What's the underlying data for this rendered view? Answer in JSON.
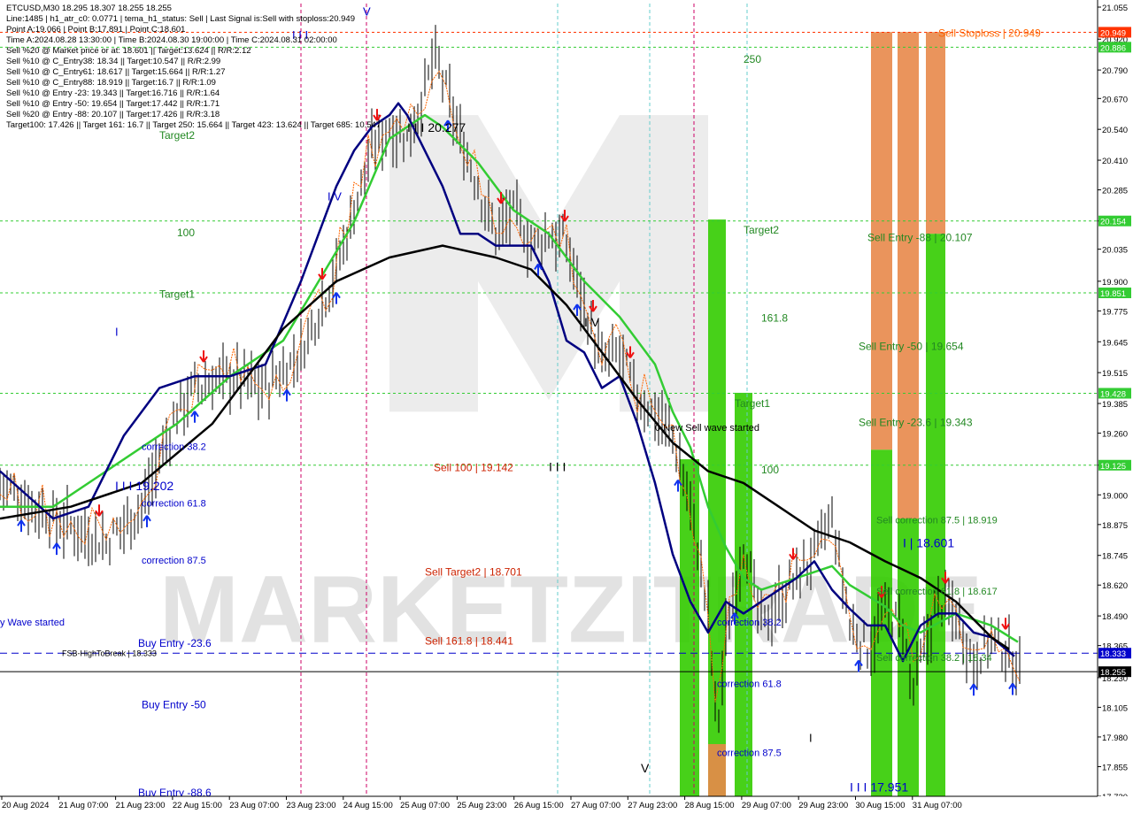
{
  "header": {
    "lines": [
      "ETCUSD,M30  18.295 18.307 18.255 18.255",
      "Line:1485 | h1_atr_c0: 0.0771 | tema_h1_status: Sell | Last Signal is:Sell with stoploss:20.949",
      "Point A:19.066 | Point B:17.891 | Point C:18.601",
      "Time A:2024.08.28 13:30:00 | Time B:2024.08.30 19:00:00 | Time C:2024.08.31 02:00:00",
      "Sell %20 @ Market price or at: 18.601 || Target:13.624 || R/R:2.12",
      "Sell %10 @ C_Entry38: 18.34 || Target:10.547 || R/R:2.99",
      "Sell %10 @ C_Entry61: 18.617 || Target:15.664 || R/R:1.27",
      "Sell %10 @ C_Entry88: 18.919 || Target:16.7 || R/R:1.09",
      "Sell %10 @ Entry -23: 19.343 || Target:16.716 || R/R:1.64",
      "Sell %10 @ Entry -50: 19.654 || Target:17.442 || R/R:1.71",
      "Sell %20 @ Entry -88: 20.107 || Target:17.426 || R/R:3.18",
      "Target100: 17.426 || Target 161: 16.7 || Target 250: 15.664 || Target 423: 13.624 || Target 685: 10.547"
    ]
  },
  "colors": {
    "bull": "#000000",
    "green_ma": "#33cc33",
    "navy_ma": "#000080",
    "black_ma": "#000000",
    "orange": "#ff6600",
    "green_zone": "#33cc00",
    "orange_zone": "#e8884a",
    "level_line": "#006600",
    "stop_line": "#ff3300",
    "blue_line": "#0000cc",
    "label_green": "#33aa33",
    "label_red": "#cc2200",
    "label_blue": "#0000cc"
  },
  "chart_data": {
    "type": "candlestick",
    "symbol": "ETCUSD",
    "timeframe": "M30",
    "ylim": [
      17.73,
      21.07
    ],
    "y_ticks": [
      "21.055",
      "20.920",
      "20.790",
      "20.670",
      "20.540",
      "20.410",
      "20.285",
      "20.154",
      "20.035",
      "19.900",
      "19.775",
      "19.645",
      "19.515",
      "19.385",
      "19.260",
      "19.125",
      "19.000",
      "18.875",
      "18.745",
      "18.620",
      "18.490",
      "18.365",
      "18.230",
      "18.105",
      "17.980",
      "17.855",
      "17.730"
    ],
    "x_labels": [
      "20 Aug 2024",
      "21 Aug 07:00",
      "21 Aug 23:00",
      "22 Aug 15:00",
      "23 Aug 07:00",
      "23 Aug 23:00",
      "24 Aug 15:00",
      "25 Aug 07:00",
      "25 Aug 23:00",
      "26 Aug 15:00",
      "27 Aug 07:00",
      "27 Aug 23:00",
      "28 Aug 15:00",
      "29 Aug 07:00",
      "29 Aug 23:00",
      "30 Aug 15:00",
      "31 Aug 07:00"
    ],
    "price_path": [
      [
        0,
        19.05
      ],
      [
        3,
        18.9
      ],
      [
        6,
        18.8
      ],
      [
        8,
        18.95
      ],
      [
        10,
        19.35
      ],
      [
        11,
        19.45
      ],
      [
        13,
        19.5
      ],
      [
        15,
        19.45
      ],
      [
        17,
        19.6
      ],
      [
        19,
        19.95
      ],
      [
        20,
        20.2
      ],
      [
        21,
        20.45
      ],
      [
        22,
        20.55
      ],
      [
        23,
        20.5
      ],
      [
        24,
        20.7
      ],
      [
        24.5,
        20.85
      ],
      [
        25,
        20.75
      ],
      [
        26,
        20.5
      ],
      [
        27,
        20.3
      ],
      [
        28,
        20.1
      ],
      [
        29,
        20.2
      ],
      [
        30,
        20.05
      ],
      [
        31,
        20.1
      ],
      [
        32,
        20.05
      ],
      [
        33,
        19.8
      ],
      [
        34,
        19.55
      ],
      [
        35,
        19.6
      ],
      [
        36,
        19.4
      ],
      [
        37,
        19.35
      ],
      [
        38,
        19.25
      ],
      [
        39,
        18.95
      ],
      [
        40,
        18.5
      ],
      [
        40.5,
        18.0
      ],
      [
        41,
        18.4
      ],
      [
        42,
        18.8
      ],
      [
        43,
        18.45
      ],
      [
        44,
        18.55
      ],
      [
        45,
        18.65
      ],
      [
        46,
        18.75
      ],
      [
        47,
        18.9
      ],
      [
        48,
        18.45
      ],
      [
        49,
        18.35
      ],
      [
        50,
        18.5
      ],
      [
        51,
        18.45
      ],
      [
        51.5,
        18.15
      ],
      [
        52,
        18.3
      ],
      [
        53,
        18.55
      ],
      [
        54,
        18.5
      ],
      [
        55,
        18.3
      ],
      [
        56,
        18.4
      ],
      [
        57,
        18.32
      ],
      [
        57.7,
        18.26
      ]
    ],
    "series": [
      {
        "name": "",
        "color": "green",
        "values": [
          [
            0,
            18.95
          ],
          [
            3,
            18.95
          ],
          [
            6,
            19.1
          ],
          [
            10,
            19.3
          ],
          [
            13,
            19.5
          ],
          [
            16,
            19.65
          ],
          [
            18,
            19.9
          ],
          [
            20,
            20.15
          ],
          [
            22,
            20.5
          ],
          [
            24,
            20.6
          ],
          [
            25,
            20.55
          ],
          [
            27,
            20.4
          ],
          [
            29,
            20.2
          ],
          [
            31,
            20.1
          ],
          [
            33,
            19.9
          ],
          [
            35,
            19.75
          ],
          [
            37,
            19.55
          ],
          [
            38,
            19.35
          ],
          [
            39,
            19.2
          ],
          [
            40,
            18.95
          ],
          [
            41,
            18.78
          ],
          [
            42,
            18.65
          ],
          [
            43,
            18.6
          ],
          [
            45,
            18.65
          ],
          [
            47,
            18.7
          ],
          [
            48,
            18.62
          ],
          [
            50,
            18.53
          ],
          [
            51,
            18.45
          ],
          [
            52,
            18.42
          ],
          [
            54,
            18.5
          ],
          [
            56,
            18.45
          ],
          [
            57.5,
            18.38
          ]
        ]
      },
      {
        "name": "",
        "color": "navy",
        "values": [
          [
            0,
            19.1
          ],
          [
            3,
            18.9
          ],
          [
            5,
            18.95
          ],
          [
            7,
            19.25
          ],
          [
            9,
            19.45
          ],
          [
            11,
            19.5
          ],
          [
            13,
            19.5
          ],
          [
            15,
            19.55
          ],
          [
            17,
            19.9
          ],
          [
            19,
            20.3
          ],
          [
            20,
            20.45
          ],
          [
            21,
            20.55
          ],
          [
            22,
            20.6
          ],
          [
            22.5,
            20.65
          ],
          [
            23,
            20.6
          ],
          [
            24,
            20.45
          ],
          [
            25,
            20.3
          ],
          [
            26,
            20.1
          ],
          [
            27,
            20.1
          ],
          [
            28,
            20.05
          ],
          [
            30,
            20.05
          ],
          [
            31,
            19.9
          ],
          [
            32,
            19.65
          ],
          [
            33,
            19.6
          ],
          [
            34,
            19.45
          ],
          [
            35,
            19.5
          ],
          [
            36,
            19.3
          ],
          [
            37,
            19.05
          ],
          [
            38,
            18.75
          ],
          [
            39,
            18.55
          ],
          [
            40,
            18.42
          ],
          [
            41,
            18.55
          ],
          [
            42,
            18.5
          ],
          [
            43,
            18.55
          ],
          [
            45,
            18.65
          ],
          [
            46,
            18.72
          ],
          [
            47,
            18.6
          ],
          [
            48,
            18.52
          ],
          [
            49,
            18.45
          ],
          [
            50,
            18.45
          ],
          [
            51,
            18.3
          ],
          [
            52,
            18.45
          ],
          [
            53,
            18.5
          ],
          [
            54,
            18.5
          ],
          [
            55,
            18.42
          ],
          [
            56,
            18.4
          ],
          [
            57.3,
            18.32
          ]
        ]
      },
      {
        "name": "",
        "color": "black",
        "values": [
          [
            0,
            18.9
          ],
          [
            4,
            18.95
          ],
          [
            8,
            19.05
          ],
          [
            12,
            19.3
          ],
          [
            16,
            19.7
          ],
          [
            19,
            19.9
          ],
          [
            22,
            20.0
          ],
          [
            25,
            20.05
          ],
          [
            28,
            20.0
          ],
          [
            30,
            19.95
          ],
          [
            32,
            19.8
          ],
          [
            34,
            19.6
          ],
          [
            36,
            19.4
          ],
          [
            38,
            19.22
          ],
          [
            40,
            19.1
          ],
          [
            42,
            19.05
          ],
          [
            44,
            18.95
          ],
          [
            46,
            18.85
          ],
          [
            48,
            18.8
          ],
          [
            50,
            18.72
          ],
          [
            52,
            18.65
          ],
          [
            54,
            18.55
          ],
          [
            56,
            18.4
          ],
          [
            57,
            18.35
          ]
        ]
      }
    ],
    "levels": [
      {
        "value": 20.949,
        "label": "20.949",
        "color": "#ff3300"
      },
      {
        "value": 20.886,
        "label": "20.886",
        "color": "#33cc33"
      },
      {
        "value": 20.154,
        "label": "20.154",
        "color": "#33cc33"
      },
      {
        "value": 19.851,
        "label": "19.851",
        "color": "#33cc33"
      },
      {
        "value": 19.428,
        "label": "19.428",
        "color": "#33cc33"
      },
      {
        "value": 19.125,
        "label": "19.125",
        "color": "#33cc33"
      },
      {
        "value": 18.333,
        "label": "18.333",
        "color": "#0000cc"
      },
      {
        "value": 18.255,
        "label": "18.255",
        "color": "#000000"
      }
    ],
    "annotations": [
      {
        "text": "Sell Stoploss | 20.949",
        "x": 53.0,
        "y": 20.93,
        "color": "#ff6600",
        "size": 12
      },
      {
        "text": "250",
        "x": 42.0,
        "y": 20.82,
        "color": "#228822",
        "size": 12
      },
      {
        "text": "Target2",
        "x": 9.0,
        "y": 20.5,
        "color": "#228822",
        "size": 12
      },
      {
        "text": "I I I 20.277",
        "x": 23.0,
        "y": 20.53,
        "color": "#000000",
        "size": 14
      },
      {
        "text": "I V",
        "x": 18.5,
        "y": 20.24,
        "color": "#0000cc",
        "size": 13
      },
      {
        "text": "100",
        "x": 10.0,
        "y": 20.09,
        "color": "#228822",
        "size": 12
      },
      {
        "text": "Target2",
        "x": 42.0,
        "y": 20.1,
        "color": "#228822",
        "size": 12
      },
      {
        "text": "Sell Entry -88 | 20.107",
        "x": 49.0,
        "y": 20.07,
        "color": "#228822",
        "size": 12
      },
      {
        "text": "Target1",
        "x": 9.0,
        "y": 19.83,
        "color": "#228822",
        "size": 12
      },
      {
        "text": "161.8",
        "x": 43.0,
        "y": 19.73,
        "color": "#228822",
        "size": 12
      },
      {
        "text": "I V",
        "x": 33.0,
        "y": 19.71,
        "color": "#000000",
        "size": 14
      },
      {
        "text": "I",
        "x": 6.5,
        "y": 19.67,
        "color": "#0000cc",
        "size": 13
      },
      {
        "text": "Sell Entry -50 | 19.654",
        "x": 48.5,
        "y": 19.61,
        "color": "#228822",
        "size": 12
      },
      {
        "text": "Target1",
        "x": 41.5,
        "y": 19.37,
        "color": "#228822",
        "size": 12
      },
      {
        "text": "0 New Sell wave started",
        "x": 37.0,
        "y": 19.27,
        "color": "#000000",
        "size": 11
      },
      {
        "text": "Sell Entry -23.6 | 19.343",
        "x": 48.5,
        "y": 19.29,
        "color": "#228822",
        "size": 12
      },
      {
        "text": "correction 38.2",
        "x": 8.0,
        "y": 19.19,
        "color": "#0000cc",
        "size": 11
      },
      {
        "text": "Sell 100 | 19.142",
        "x": 24.5,
        "y": 19.1,
        "color": "#cc2200",
        "size": 12
      },
      {
        "text": "I I I",
        "x": 31.0,
        "y": 19.1,
        "color": "#000000",
        "size": 14
      },
      {
        "text": "100",
        "x": 43.0,
        "y": 19.09,
        "color": "#228822",
        "size": 12
      },
      {
        "text": "I I I 19.202",
        "x": 6.5,
        "y": 19.02,
        "color": "#0000cc",
        "size": 14
      },
      {
        "text": "correction 61.8",
        "x": 8.0,
        "y": 18.95,
        "color": "#0000cc",
        "size": 11
      },
      {
        "text": "Sell correction 87.5 | 18.919",
        "x": 49.5,
        "y": 18.88,
        "color": "#228822",
        "size": 11
      },
      {
        "text": "I | 18.601",
        "x": 51.0,
        "y": 18.78,
        "color": "#0000cc",
        "size": 14
      },
      {
        "text": "correction 87.5",
        "x": 8.0,
        "y": 18.71,
        "color": "#0000cc",
        "size": 11
      },
      {
        "text": "Sell Target2 | 18.701",
        "x": 24.0,
        "y": 18.66,
        "color": "#cc2200",
        "size": 12
      },
      {
        "text": "Sell correction 61.8 | 18.617",
        "x": 49.5,
        "y": 18.58,
        "color": "#228822",
        "size": 11
      },
      {
        "text": "y Wave started",
        "x": 0.0,
        "y": 18.45,
        "color": "#0000cc",
        "size": 11
      },
      {
        "text": "correction 38.2",
        "x": 40.5,
        "y": 18.45,
        "color": "#0000cc",
        "size": 11
      },
      {
        "text": "Buy Entry -23.6",
        "x": 7.8,
        "y": 18.36,
        "color": "#0000cc",
        "size": 12
      },
      {
        "text": "Sell 161.8 | 18.441",
        "x": 24.0,
        "y": 18.37,
        "color": "#cc2200",
        "size": 12
      },
      {
        "text": "FSB-HighToBreak | 18.333",
        "x": 3.5,
        "y": 18.32,
        "color": "#000000",
        "size": 9
      },
      {
        "text": "Sell correction 38.2 | 18.34",
        "x": 49.5,
        "y": 18.3,
        "color": "#228822",
        "size": 11
      },
      {
        "text": "correction 61.8",
        "x": 40.5,
        "y": 18.19,
        "color": "#0000cc",
        "size": 11
      },
      {
        "text": "Buy Entry -50",
        "x": 8.0,
        "y": 18.1,
        "color": "#0000cc",
        "size": 12
      },
      {
        "text": "I",
        "x": 45.7,
        "y": 17.96,
        "color": "#000000",
        "size": 13
      },
      {
        "text": "correction 87.5",
        "x": 40.5,
        "y": 17.9,
        "color": "#0000cc",
        "size": 11
      },
      {
        "text": "V",
        "x": 36.2,
        "y": 17.83,
        "color": "#000000",
        "size": 14
      },
      {
        "text": "I I I 17.951",
        "x": 48.0,
        "y": 17.75,
        "color": "#0000cc",
        "size": 14
      },
      {
        "text": "Buy Entry -88.6",
        "x": 7.8,
        "y": 17.73,
        "color": "#0000cc",
        "size": 12
      },
      {
        "text": "V",
        "x": 20.5,
        "y": 21.02,
        "color": "#0000cc",
        "size": 13
      },
      {
        "text": "I I I",
        "x": 16.5,
        "y": 20.92,
        "color": "#0000cc",
        "size": 13
      }
    ],
    "zones": [
      {
        "color": "#e8884a",
        "x0": 49.2,
        "x1": 50.4,
        "y0": 19.19,
        "y1": 20.95
      },
      {
        "color": "#33cc00",
        "x0": 49.2,
        "x1": 50.4,
        "y0": 17.73,
        "y1": 19.19
      },
      {
        "color": "#e8884a",
        "x0": 50.7,
        "x1": 51.9,
        "y0": 18.9,
        "y1": 20.95
      },
      {
        "color": "#33cc00",
        "x0": 50.7,
        "x1": 51.9,
        "y0": 17.73,
        "y1": 18.9
      },
      {
        "color": "#e8884a",
        "x0": 52.3,
        "x1": 53.4,
        "y0": 20.1,
        "y1": 20.95
      },
      {
        "color": "#33cc00",
        "x0": 52.3,
        "x1": 53.4,
        "y0": 17.73,
        "y1": 20.1
      },
      {
        "color": "#33cc00",
        "x0": 38.4,
        "x1": 39.5,
        "y0": 17.73,
        "y1": 19.15
      },
      {
        "color": "#33cc00",
        "x0": 40.0,
        "x1": 41.0,
        "y0": 17.73,
        "y1": 20.16
      },
      {
        "color": "#e8884a",
        "x0": 40.0,
        "x1": 41.0,
        "y0": 17.73,
        "y1": 17.95
      },
      {
        "color": "#33cc00",
        "x0": 41.5,
        "x1": 42.5,
        "y0": 17.73,
        "y1": 19.43
      }
    ],
    "vertical_lines": [
      {
        "x": 17.0,
        "color": "#cc0066"
      },
      {
        "x": 20.7,
        "color": "#cc0066"
      },
      {
        "x": 39.2,
        "color": "#cc0066"
      },
      {
        "x": 31.5,
        "color": "#66cccc"
      },
      {
        "x": 36.7,
        "color": "#66cccc"
      },
      {
        "x": 42.2,
        "color": "#66cccc"
      }
    ],
    "watermark": "MARKETZITRADE"
  }
}
